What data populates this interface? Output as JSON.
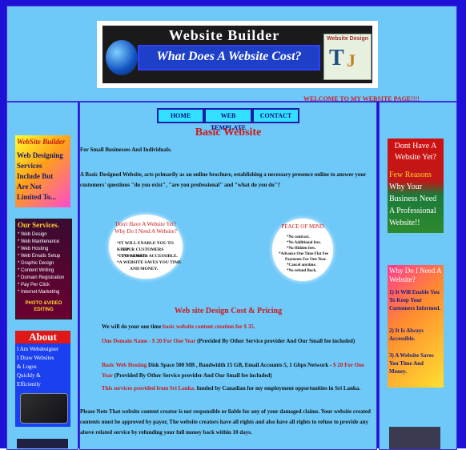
{
  "header": {
    "banner_title": "Website Builder",
    "banner_subtitle": "What Does A Website Cost?",
    "logo_text": "Website Design",
    "logo_letters": [
      "T",
      "J"
    ],
    "welcome": "WELCOME TO MY WEBSITE PAGE!!!!"
  },
  "nav": {
    "home": "HOME",
    "web_template": "WEB TEMPLATE",
    "contact": "CONTACT"
  },
  "main": {
    "title": "Basic Website",
    "intro": "For Small Businesses And Individuals.",
    "description": "A Basic Designed Website, acts primarily as an online brochure, establishing a necessary presence online to answer your customers' questions \"do you exist\", \"are you professional\" and \"what do you do\"?",
    "oval_left": {
      "title_line1": "Don't Have A Website Yet?",
      "title_line2": "Why Do I Need A Website?",
      "lines": [
        "*IT WILL ENABLE YOU TO KEEP",
        "YOUR CUSTOMERS INFORMED.",
        "*IT IS ALWAYS ACCESSIBLE.",
        "*A WEBSITE SAVES YOU TIME",
        "AND MONEY."
      ]
    },
    "oval_right": {
      "title": "PEACE OF MIND",
      "lines": [
        "*No contract.",
        "*No Additional fees.",
        "*No Hidden fees.",
        "*Advance One Time Flat Fee",
        "Payments For One Year.",
        "*Cancel anytime.",
        "*No refund Back."
      ]
    },
    "cost_title": "Web site Design Cost & Pricing",
    "one_time_prefix": "We will do your one time ",
    "one_time_highlight": "basic website content creation for $ 35.",
    "domain_highlight": "One Domain Name - $ 20 For One Year",
    "domain_rest": " (Provided By Other Service provider And Our Small fee included)",
    "hosting_highlight": "Basic Web Hosting",
    "hosting_mid": " Disk Space 500 MB , Bandwidth 15 GB, Email Accounts 5, 1 Gbps Network - ",
    "hosting_price": "$ 20 For One Year",
    "hosting_rest": " (Provided By Other Service provider And Our Small fee included)",
    "srilanka_highlight": "This services provided from Sri Lanka.",
    "srilanka_rest": " funded by Canadian for my employment opportunities in Sri Lanka.",
    "note": "Please Note That website content creator is not responsible or liable for any of your damaged claims. Your website created contents must be approved by payor, The website creators have all rights and also have all rights to refuse to provide any above related service by refunding your full money back within 10 days."
  },
  "left_sidebar": {
    "card1": [
      "WebSite Builder",
      "Web Designing",
      "Services",
      "Include But",
      "Are Not",
      "Limited To..."
    ],
    "card2_title": "Our Services.",
    "card2_items": [
      "* Web Design",
      "* Web Maintenance",
      "* Web Hosting",
      "* Web Emails Setup",
      "* Graphic Design",
      "* Content Writing",
      "* Domain Registration",
      "* Pay Per Click",
      "* Internet Marketing"
    ],
    "card2_footer": "PHOTO &VIDEO EDITING",
    "card3_title": "About",
    "card3_lines": [
      "I Am Webdesigner",
      "I Draw Websites",
      "& Logos",
      "Quickly &",
      "Efficiently"
    ]
  },
  "right_sidebar": {
    "card1": [
      "Dont Have A",
      "Website Yet?",
      "Few Reasons",
      "Why Your",
      "Business Need",
      "A Professional",
      "Website!!"
    ],
    "card2_title": "Why Do I Need A Website?",
    "card2_items": [
      "1) It Will Enable You To Keep Your Customers Informed.",
      "2) It Is Always Accessible.",
      "3) A Website Saves You Time And Money."
    ]
  },
  "colors": {
    "background": "#1f10d8",
    "panel": "#6ec8f8",
    "accent_red": "#cc1a1a",
    "nav_button": "#33e0ff"
  }
}
